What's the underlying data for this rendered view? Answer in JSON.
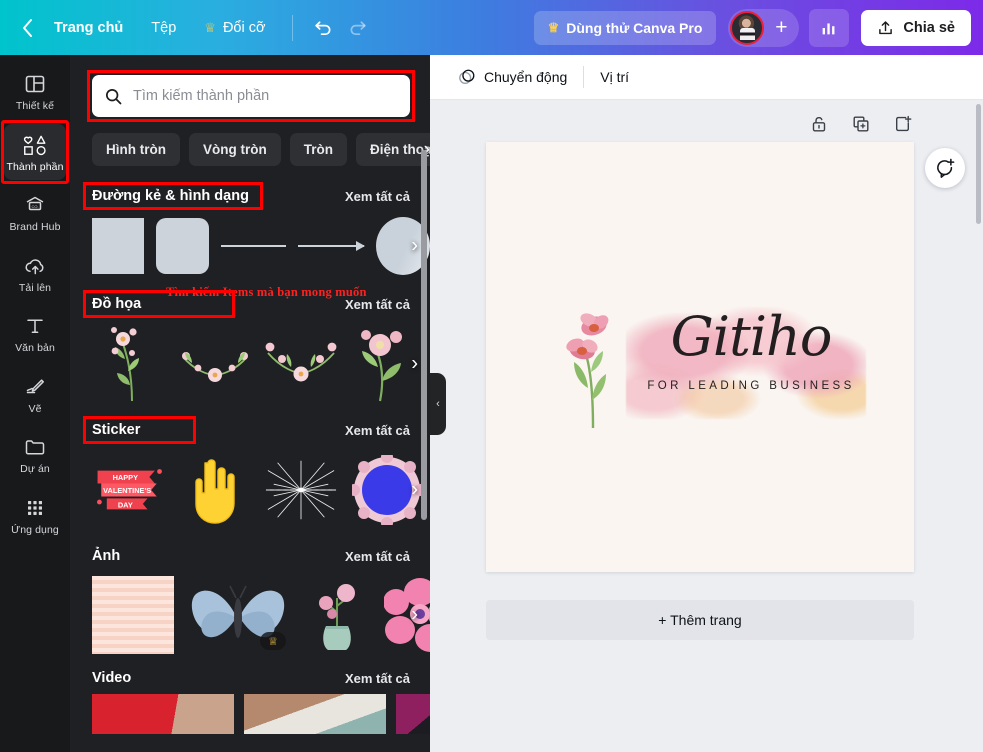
{
  "topbar": {
    "back_icon": "chevron-left-icon",
    "home_label": "Trang chủ",
    "file_label": "Tệp",
    "resize_label": "Đổi cỡ",
    "resize_icon": "crown-icon",
    "undo_icon": "undo-icon",
    "redo_icon": "redo-icon",
    "pro_label": "Dùng thử Canva Pro",
    "pro_icon": "crown-icon",
    "avatar_name": "avatar",
    "add_member_label": "+",
    "analytics_icon": "bar-chart-icon",
    "share_label": "Chia sẻ",
    "share_icon": "upload-icon",
    "gradient_start": "#00c4cc",
    "gradient_end": "#7d2ae8"
  },
  "rail": {
    "items": [
      {
        "label": "Thiết kế",
        "icon": "layout-icon",
        "active": false
      },
      {
        "label": "Thành phần",
        "icon": "shapes-icon",
        "active": true
      },
      {
        "label": "Brand Hub",
        "icon": "brand-icon",
        "active": false
      },
      {
        "label": "Tải lên",
        "icon": "upload-cloud-icon",
        "active": false
      },
      {
        "label": "Văn bản",
        "icon": "text-icon",
        "active": false
      },
      {
        "label": "Vẽ",
        "icon": "draw-icon",
        "active": false
      },
      {
        "label": "Dự án",
        "icon": "folder-icon",
        "active": false
      },
      {
        "label": "Ứng dụng",
        "icon": "apps-grid-icon",
        "active": false
      }
    ]
  },
  "panel": {
    "search": {
      "placeholder": "Tìm kiếm thành phần",
      "value": "",
      "icon": "search-icon"
    },
    "chips": [
      "Hình tròn",
      "Vòng tròn",
      "Tròn",
      "Điện thoại"
    ],
    "chips_next_icon": "chevron-right-icon",
    "see_all_label": "Xem tất cả",
    "annotation": "Tìm kiếm Items mà bạn mong muốn",
    "sections": [
      {
        "title": "Đường kẻ & hình dạng",
        "highlight": true,
        "items": [
          "square-shape",
          "rounded-square-shape",
          "line-shape",
          "arrow-shape",
          "circle-shape"
        ]
      },
      {
        "title": "Đồ họa",
        "highlight": true,
        "items": [
          "floral-sprig-graphic",
          "floral-divider-graphic",
          "floral-branch-graphic",
          "floral-bloom-graphic"
        ]
      },
      {
        "title": "Sticker",
        "highlight": true,
        "items": [
          "valentines-ribbon-sticker",
          "pointing-hand-sticker",
          "starburst-sticker",
          "blue-badge-sticker"
        ]
      },
      {
        "title": "Ảnh",
        "highlight": false,
        "items": [
          "striped-pattern-photo",
          "butterfly-photo",
          "flower-vase-photo",
          "pink-flower-photo"
        ]
      },
      {
        "title": "Video",
        "highlight": false,
        "items": [
          "red-video",
          "interior-video",
          "pink-video"
        ]
      }
    ],
    "collapse_icon": "chevron-left-icon",
    "highlight_color": "#ff0000",
    "background": "#1f2023"
  },
  "stage": {
    "toolbar": {
      "animate_label": "Chuyển động",
      "animate_icon": "motion-icon",
      "position_label": "Vị trí"
    },
    "page_tools": [
      {
        "icon": "lock-icon",
        "name": "lock-page-button"
      },
      {
        "icon": "duplicate-icon",
        "name": "duplicate-page-button"
      },
      {
        "icon": "add-page-icon",
        "name": "add-page-button"
      }
    ],
    "comment_icon": "comment-add-icon",
    "add_page_label": "+ Thêm trang",
    "design": {
      "brand_name": "Gitiho",
      "tagline": "FOR LEADING BUSINESS",
      "background": "#faf5f0",
      "accent": "#f0b0be"
    }
  }
}
